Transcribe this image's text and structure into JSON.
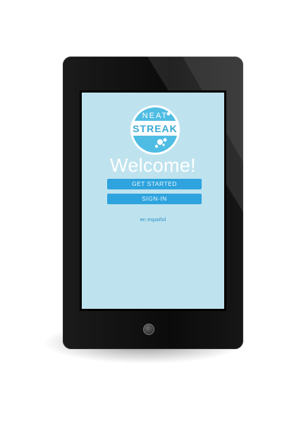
{
  "logo": {
    "top_text": "NEAT",
    "main_text": "STREAK"
  },
  "screen": {
    "welcome": "Welcome!",
    "get_started_label": "GET STARTED",
    "sign_in_label": "SIGN-IN",
    "language_link": "en español"
  },
  "colors": {
    "screen_bg": "#bfe3ee",
    "button_bg": "#2ea3de",
    "logo_accent": "#4fbde3",
    "device_body": "#111111"
  },
  "icons": [
    "app-logo",
    "bubbles-icon",
    "home-button-icon"
  ]
}
